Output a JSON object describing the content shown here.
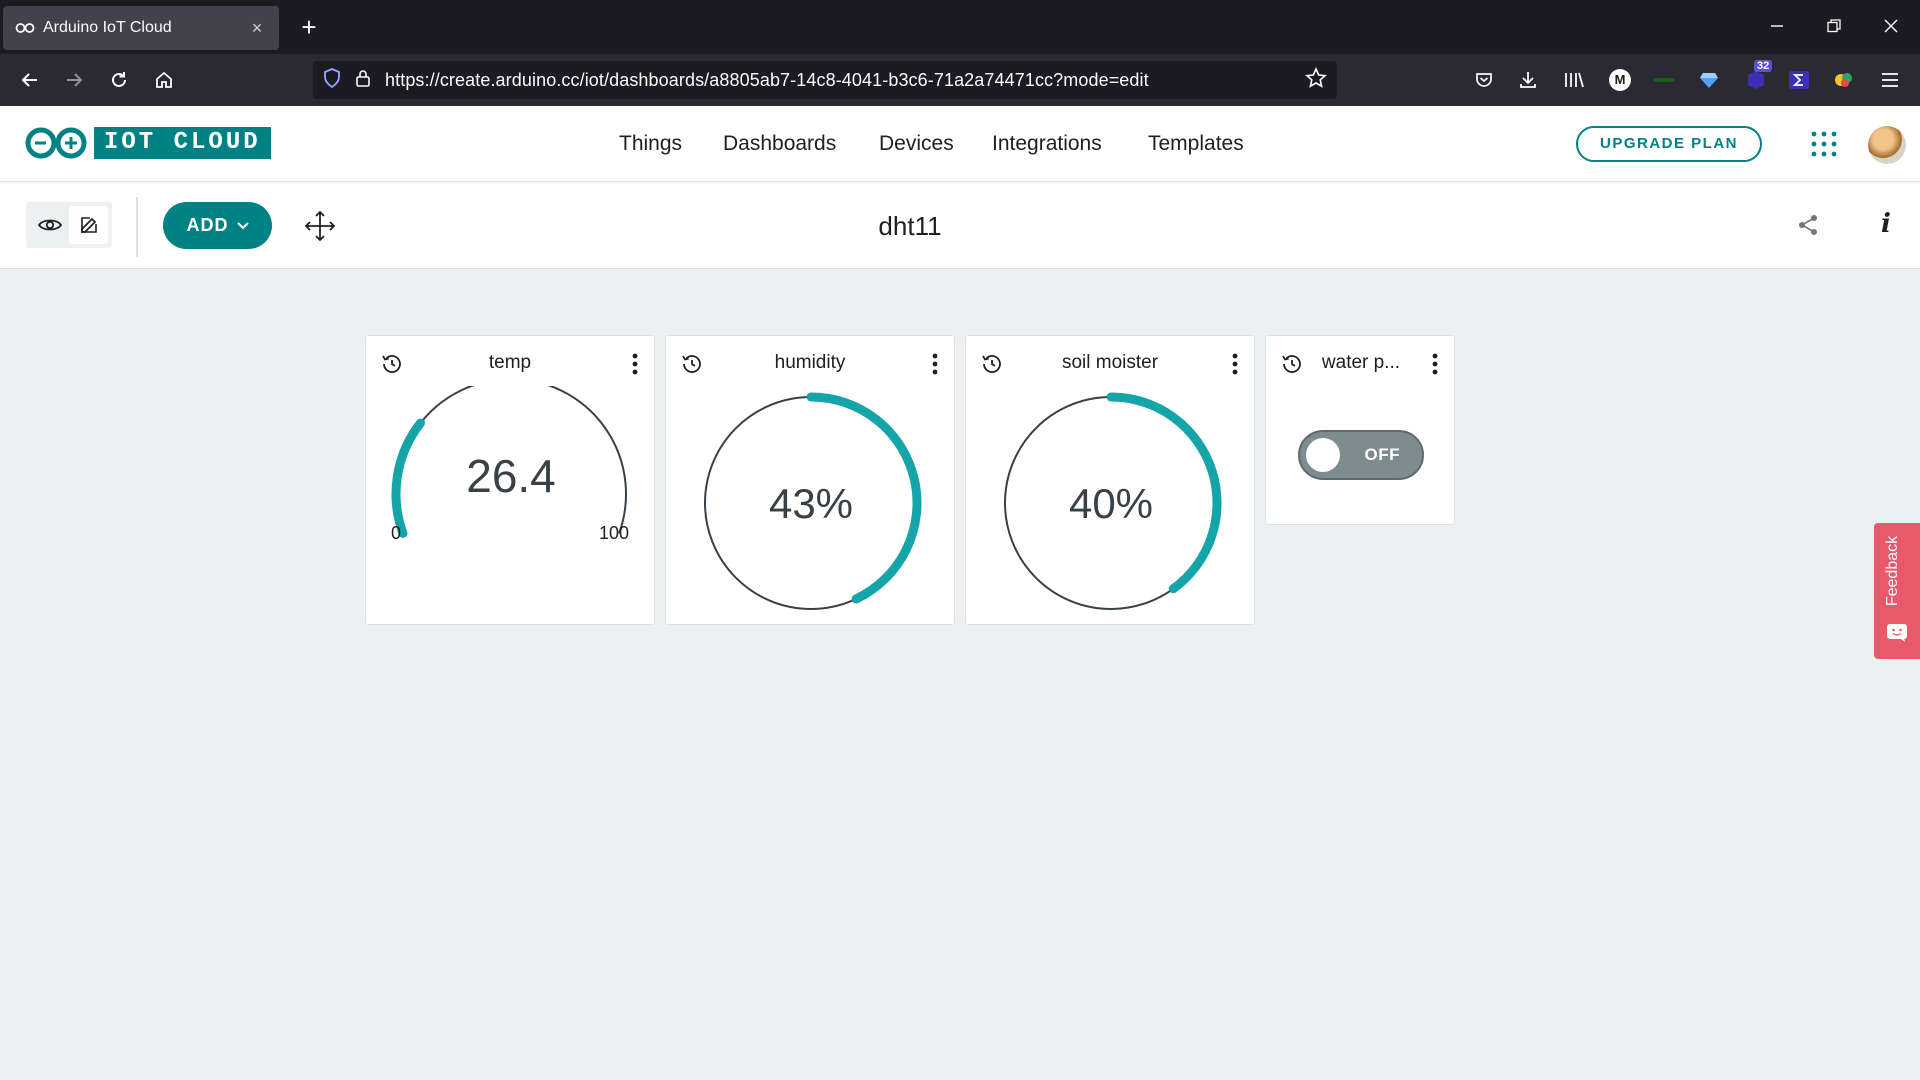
{
  "browser": {
    "tab_title": "Arduino IoT Cloud",
    "tab_close": "×",
    "new_tab": "+",
    "url": "https://create.arduino.cc/iot/dashboards/a8805ab7-14c8-4041-b3c6-71a2a74471cc?mode=edit",
    "extension_badge": "32",
    "extension_m": "M"
  },
  "app": {
    "logo_text": "IOT CLOUD",
    "nav": [
      "Things",
      "Dashboards",
      "Devices",
      "Integrations",
      "Templates"
    ],
    "upgrade_label": "UPGRADE PLAN"
  },
  "toolbar": {
    "add_label": "ADD",
    "dashboard_title": "dht11"
  },
  "widgets": {
    "temp": {
      "title": "temp",
      "value": "26.4",
      "min": "0",
      "max": "100",
      "fraction": 0.264
    },
    "humidity": {
      "title": "humidity",
      "value": "43%",
      "fraction": 0.43
    },
    "soil": {
      "title": "soil moister",
      "value": "40%",
      "fraction": 0.4
    },
    "water": {
      "title": "water p...",
      "state": "OFF"
    }
  },
  "feedback": {
    "label": "Feedback"
  },
  "colors": {
    "accent": "#008184",
    "gauge_fill": "#15a5a9",
    "gauge_track": "#374146",
    "feedback": "#e85a6b"
  }
}
